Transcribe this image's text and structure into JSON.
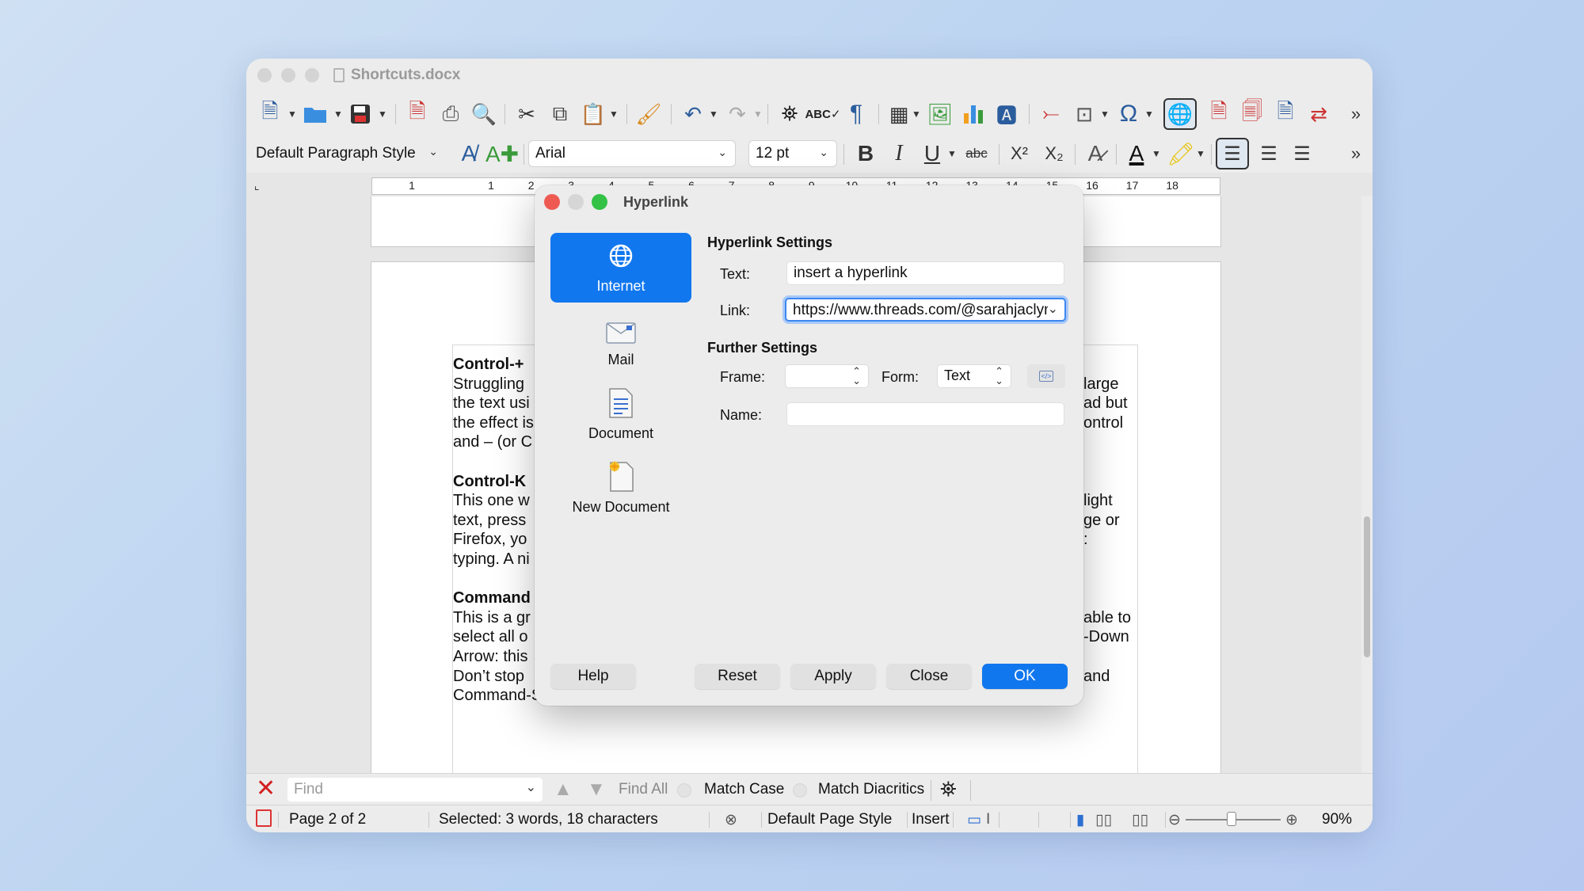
{
  "window": {
    "title": "Shortcuts.docx"
  },
  "toolbar2": {
    "paragraph_style": "Default Paragraph Style",
    "font_name": "Arial",
    "font_size": "12 pt"
  },
  "ruler": {
    "ticks": [
      "1",
      "1",
      "2",
      "3",
      "4",
      "5",
      "6",
      "7",
      "8",
      "9",
      "10",
      "11",
      "12",
      "13",
      "14",
      "15",
      "16",
      "17",
      "18"
    ]
  },
  "document": {
    "left_lines": [
      {
        "text": "Control-+",
        "bold": true
      },
      {
        "text": "Struggling",
        "bold": false
      },
      {
        "text": "the text usi",
        "bold": false
      },
      {
        "text": "the effect is",
        "bold": false
      },
      {
        "text": "and – (or C",
        "bold": false
      },
      {
        "text": "",
        "bold": false
      },
      {
        "text": "Control-K",
        "bold": true
      },
      {
        "text": "This one w",
        "bold": false
      },
      {
        "text": "text, press",
        "bold": false
      },
      {
        "text": "Firefox, yo",
        "bold": false
      },
      {
        "text": "typing. A ni",
        "bold": false
      },
      {
        "text": "",
        "bold": false
      },
      {
        "text": "Command",
        "bold": true
      },
      {
        "text": "This is a gr",
        "bold": false
      },
      {
        "text": "select all o",
        "bold": false
      },
      {
        "text": "Arrow: this",
        "bold": false
      },
      {
        "text": "Don’t stop",
        "bold": false
      },
      {
        "text": "Command-Shift-Right Arrow for all text to the right.",
        "bold": false
      }
    ],
    "right_lines": [
      {
        "text": "large",
        "row": 1
      },
      {
        "text": "ad but",
        "row": 2
      },
      {
        "text": "ontrol",
        "row": 3
      },
      {
        "text": "light",
        "row": 7
      },
      {
        "text": "ge or",
        "row": 8
      },
      {
        "text": ":",
        "row": 9
      },
      {
        "text": "able to",
        "row": 13
      },
      {
        "text": "-Down",
        "row": 14
      },
      {
        "text": "and",
        "row": 16
      }
    ]
  },
  "findbar": {
    "placeholder": "Find",
    "find_all": "Find All",
    "match_case": "Match Case",
    "match_diacritics": "Match Diacritics"
  },
  "statusbar": {
    "page": "Page 2 of 2",
    "selection": "Selected: 3 words, 18 characters",
    "page_style": "Default Page Style",
    "mode": "Insert",
    "zoom": "90%"
  },
  "dialog": {
    "title": "Hyperlink",
    "nav": [
      {
        "label": "Internet",
        "active": true
      },
      {
        "label": "Mail",
        "active": false
      },
      {
        "label": "Document",
        "active": false
      },
      {
        "label": "New Document",
        "active": false
      }
    ],
    "hyperlink_settings": "Hyperlink Settings",
    "text_label": "Text:",
    "text_value": "insert a hyperlink",
    "link_label": "Link:",
    "link_value": "https://www.threads.com/@sarahjaclyn",
    "further_settings": "Further Settings",
    "frame_label": "Frame:",
    "frame_value": "",
    "form_label": "Form:",
    "form_value": "Text",
    "name_label": "Name:",
    "name_value": "",
    "buttons": {
      "help": "Help",
      "reset": "Reset",
      "apply": "Apply",
      "close": "Close",
      "ok": "OK"
    }
  },
  "colors": {
    "accent": "#1177ee",
    "close_dot": "#ee5a52",
    "zoom_dot": "#33c146"
  }
}
